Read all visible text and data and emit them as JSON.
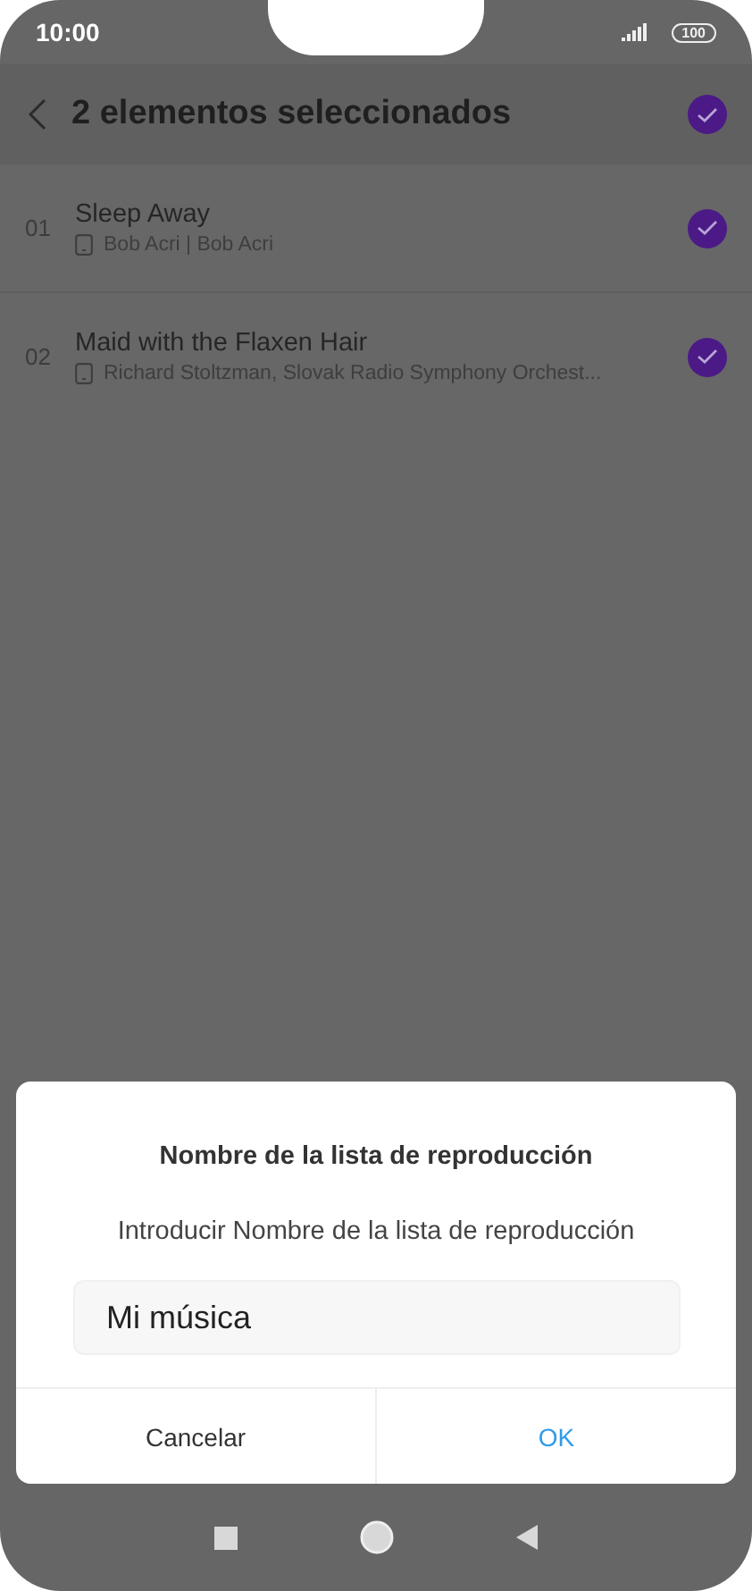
{
  "status_bar": {
    "time": "10:00",
    "battery": "100"
  },
  "header": {
    "title": "2 elementos seleccionados",
    "all_selected": true
  },
  "songs": [
    {
      "number": "01",
      "title": "Sleep Away",
      "artist": "Bob Acri | Bob Acri",
      "selected": true
    },
    {
      "number": "02",
      "title": "Maid with the Flaxen Hair",
      "artist": "Richard Stoltzman, Slovak Radio Symphony Orchest...",
      "selected": true
    }
  ],
  "dialog": {
    "title": "Nombre de la lista de reproducción",
    "message": "Introducir Nombre de la lista de reproducción",
    "input": {
      "value": "Mi música"
    },
    "buttons": [
      {
        "label": "Cancelar",
        "kind": "cancel"
      },
      {
        "label": "OK",
        "kind": "confirm"
      }
    ]
  }
}
